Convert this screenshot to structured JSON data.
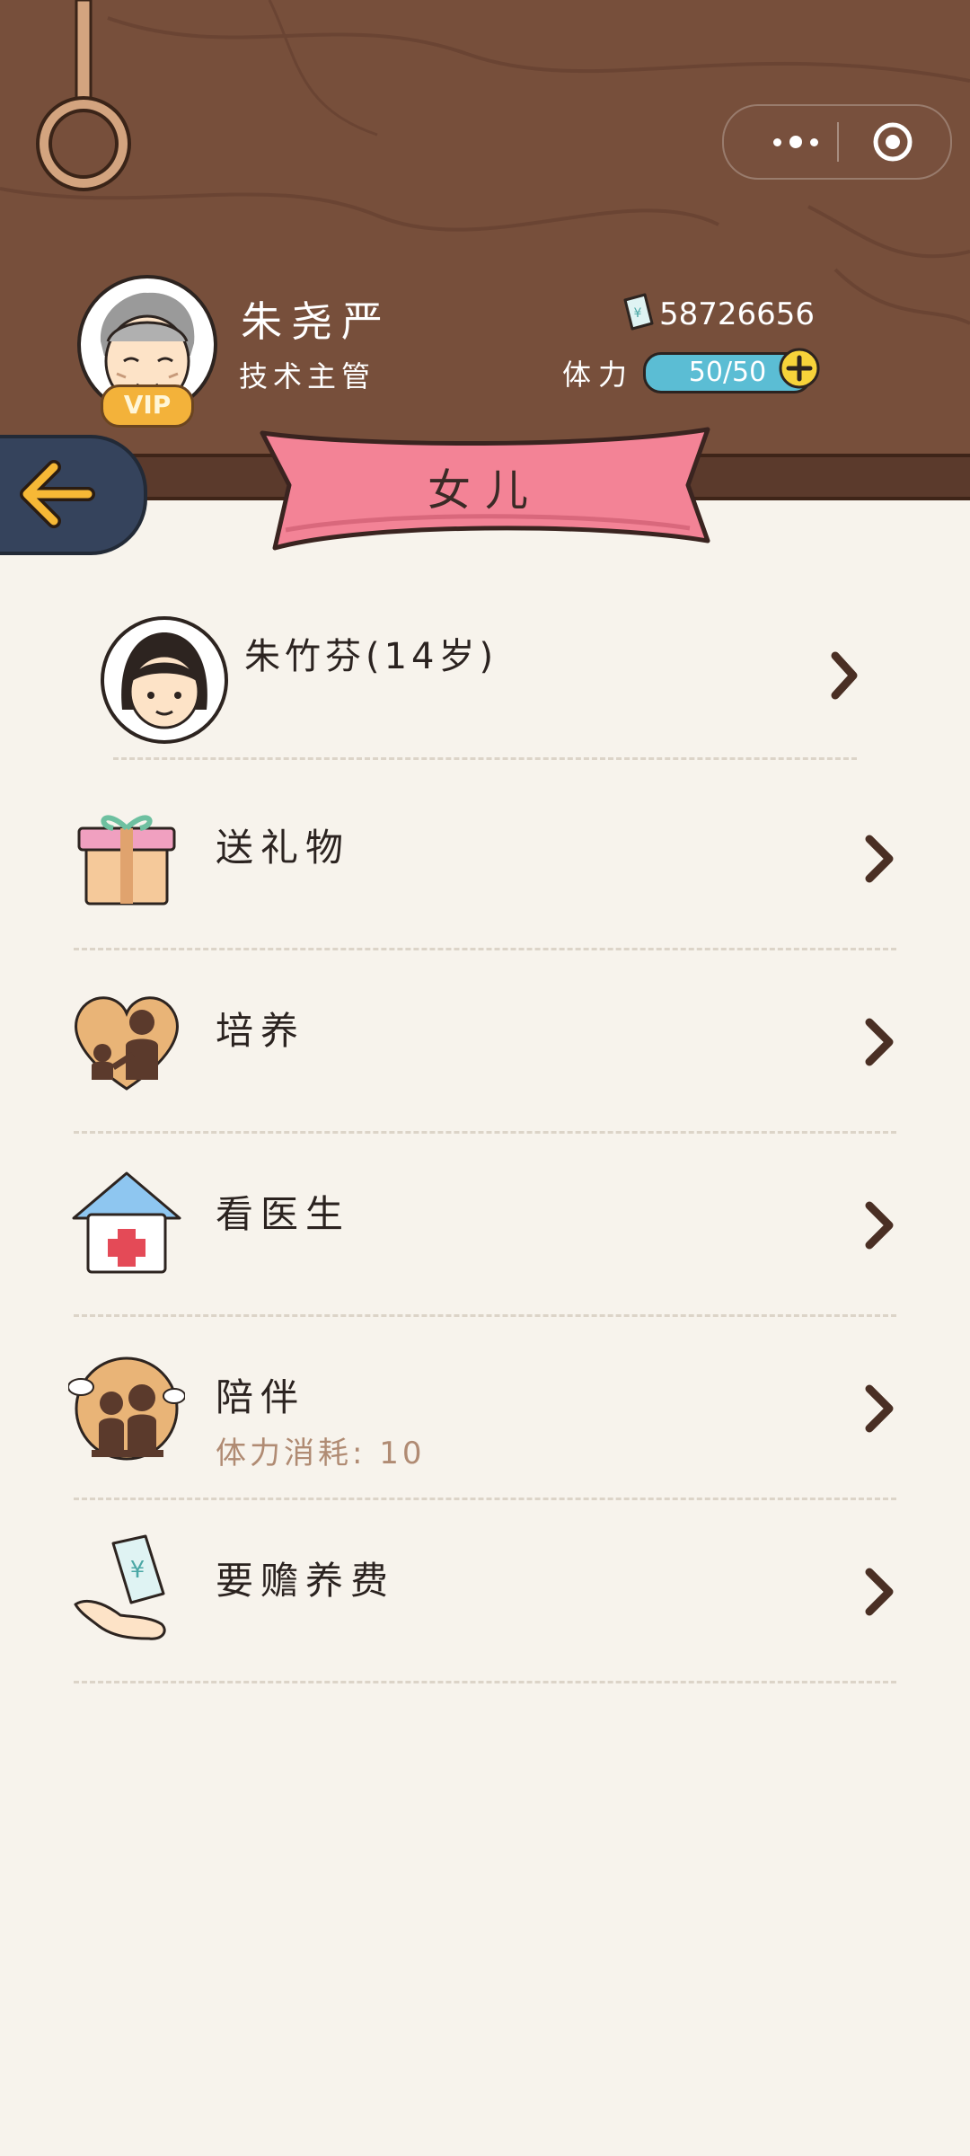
{
  "player": {
    "name": "朱尧严",
    "title": "技术主管",
    "vip_label": "VIP",
    "money": "58726656",
    "stamina_label": "体力",
    "stamina": "50/50"
  },
  "page": {
    "title": "女儿"
  },
  "child": {
    "name": "朱竹芬(14岁)"
  },
  "actions": [
    {
      "label": "送礼物",
      "icon": "gift-icon"
    },
    {
      "label": "培养",
      "icon": "nurture-heart-icon"
    },
    {
      "label": "看医生",
      "icon": "clinic-icon"
    },
    {
      "label": "陪伴",
      "icon": "family-icon",
      "note": "体力消耗: 10"
    },
    {
      "label": "要赡养费",
      "icon": "alimony-money-hand-icon"
    }
  ],
  "colors": {
    "header_wood": "#774f3b",
    "ribbon": "#f38396",
    "stamina_bar": "#5bbdd4",
    "background": "#f7f3ec"
  }
}
